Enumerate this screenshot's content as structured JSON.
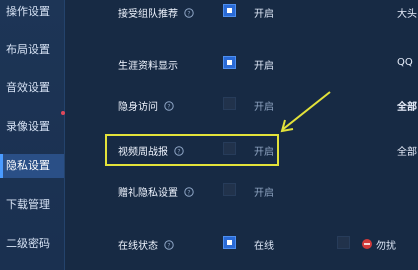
{
  "sidebar": {
    "items": [
      {
        "label": "操作设置",
        "active": false
      },
      {
        "label": "布局设置",
        "active": false
      },
      {
        "label": "音效设置",
        "active": false
      },
      {
        "label": "录像设置",
        "active": false
      },
      {
        "label": "隐私设置",
        "active": true
      },
      {
        "label": "下载管理",
        "active": false
      },
      {
        "label": "二级密码",
        "active": false
      }
    ]
  },
  "settings": {
    "rows": [
      {
        "label": "接受组队推荐",
        "state": "开启",
        "checked": true
      },
      {
        "label": "生涯资料显示",
        "state": "开启",
        "checked": true
      },
      {
        "label": "隐身访问",
        "state": "开启",
        "checked": false
      },
      {
        "label": "视频周战报",
        "state": "开启",
        "checked": false
      },
      {
        "label": "赠礼隐私设置",
        "state": "开启",
        "checked": false
      },
      {
        "label": "在线状态",
        "state": "在线",
        "checked": true
      }
    ],
    "online_extra": {
      "label": "勿扰",
      "icon": "no-entry-icon"
    }
  },
  "right_column": {
    "texts": [
      "大头",
      "QQ",
      "全部"
    ]
  },
  "colors": {
    "highlight": "#e3e23a",
    "checked": "#2a6ad6",
    "active_tab": "#2a4f86"
  }
}
